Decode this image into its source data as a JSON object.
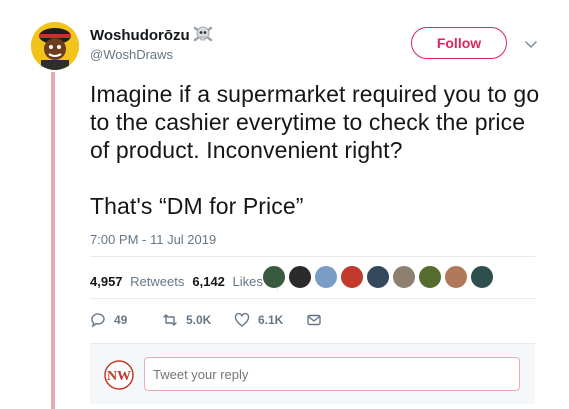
{
  "user": {
    "display_name": "Woshudorōzu",
    "handle": "@WoshDraws",
    "avatar_icon": "cartoon-avatar",
    "badge_icon": "skull-crossbones-icon"
  },
  "follow": {
    "label": "Follow"
  },
  "menu": {
    "icon": "chevron-down-icon"
  },
  "tweet": {
    "line1": "Imagine if a supermarket required you to go to the cashier everytime to check the price of product. Inconvenient right?",
    "line2": "That's “DM for Price”",
    "timestamp": "7:00 PM - 11 Jul 2019"
  },
  "stats": {
    "retweets_count": "4,957",
    "retweets_label": "Retweets",
    "likes_count": "6,142",
    "likes_label": "Likes"
  },
  "actions": {
    "reply_count": "49",
    "retweet_count": "5.0K",
    "like_count": "6.1K"
  },
  "reply": {
    "placeholder": "Tweet your reply",
    "avatar_text": "NW"
  },
  "colors": {
    "accent": "#e0245e",
    "thread_line": "#e8a8ae",
    "muted": "#657786"
  }
}
